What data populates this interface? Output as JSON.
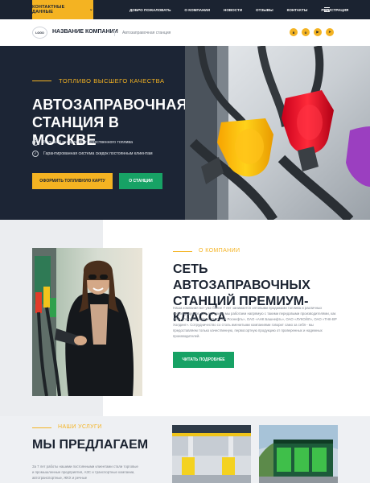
{
  "topbar": {
    "contacts_label": "КОНТАКТНЫЕ ДАННЫЕ",
    "nav": [
      "ДОБРО ПОЖАЛОВАТЬ",
      "О КОМПАНИИ",
      "НОВОСТИ",
      "ОТЗЫВЫ",
      "КОНТАКТЫ",
      "РЕГИСТРАЦИЯ"
    ]
  },
  "header": {
    "logo": "LOGO",
    "company_name": "НАЗВАНИЕ КОМПАНИИ",
    "tagline": "Автозаправочная станция",
    "socials": [
      "vk-icon",
      "odnoklassniki-icon",
      "youtube-icon",
      "telegram-icon"
    ]
  },
  "hero": {
    "kicker": "ТОПЛИВО ВЫСШЕГО КАЧЕСТВА",
    "title": "АВТОЗАПРАВОЧНАЯ СТАНЦИЯ В МОСКВЕ",
    "features": [
      "Большой ассортимент качественного топлива",
      "Гарантированная система скидок постоянным клиентам"
    ],
    "btn_card": "ОФОРМИТЬ ТОПЛИВНУЮ КАРТУ",
    "btn_about": "О СТАНЦИИ"
  },
  "about": {
    "kicker": "О КОМПАНИИ",
    "title": "СЕТЬ АВТОЗАПРАВОЧНЫХ СТАНЦИЙ ПРЕМИУМ-КЛАССА",
    "text": "Наша компания вот уже более 7 лет занимается оптовыми продажами топлива и различных нефтепродуктов. Все это время мы работаем напрямую с такими передовыми производителями, как ОАО «Газпром нефть», ОАО «НК Роснефть», ОАО «АНК Башнефть», ОАО «ЛУКОЙЛ», ОАО «ТНК-ВР Холдинг». Сотрудничество со столь именитыми компаниями говорит само за себя - мы предоставляем только качественную, первосортную продукцию от проверенных и надежных производителей.",
    "btn_more": "ЧИТАТЬ ПОДРОБНЕЕ"
  },
  "services": {
    "kicker": "НАШИ УСЛУГИ",
    "title": "МЫ ПРЕДЛАГАЕМ",
    "text": "За 7 лет работы нашими постоянными клиентами стали торговые и промышленные предприятия, АЗС и транспортные компании, автотранспортные, ЖКХ и речные"
  },
  "colors": {
    "dark": "#1b2331",
    "accent": "#f4b322",
    "green": "#17a265"
  }
}
